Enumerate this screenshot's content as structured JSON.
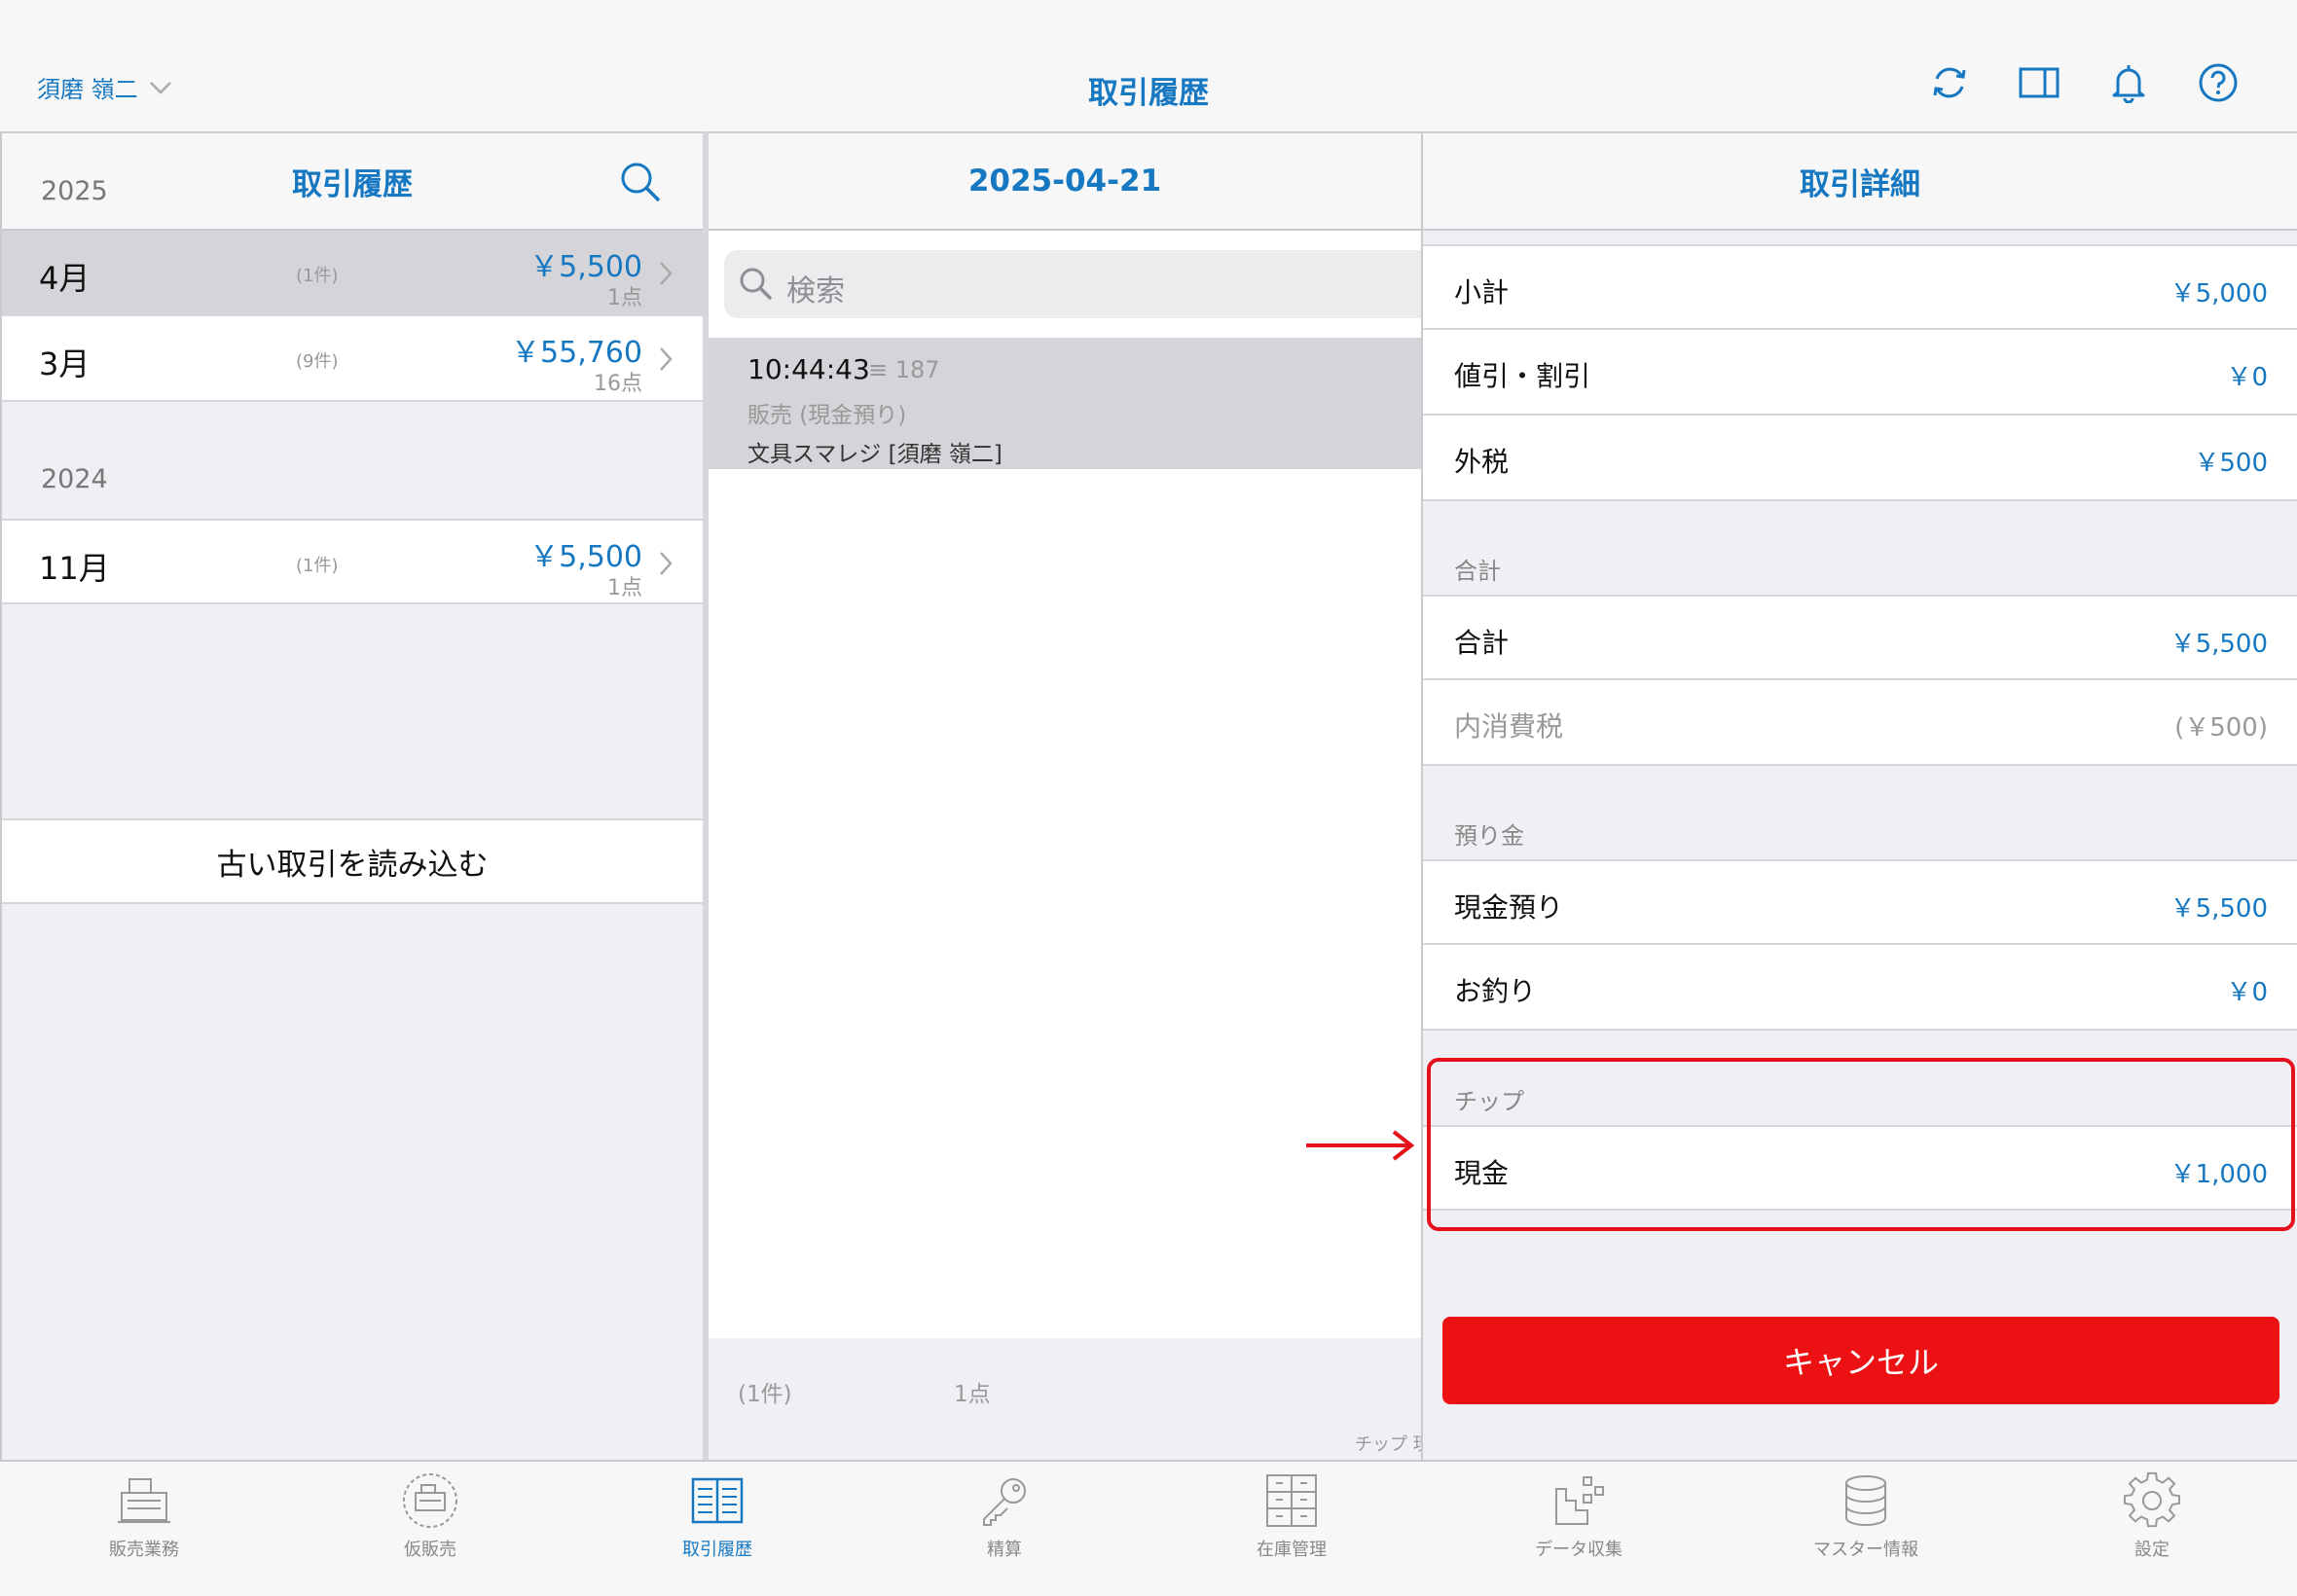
{
  "header": {
    "user": "須磨 嶺二",
    "title": "取引履歴",
    "icons": [
      "refresh-icon",
      "split-view-icon",
      "bell-icon",
      "help-icon"
    ]
  },
  "left": {
    "title": "取引履歴",
    "groups": [
      {
        "year": "2025",
        "months": [
          {
            "month": "4月",
            "count": "(1件)",
            "amount": "￥5,500",
            "points": "1点",
            "selected": true
          },
          {
            "month": "3月",
            "count": "(9件)",
            "amount": "￥55,760",
            "points": "16点",
            "selected": false
          }
        ]
      },
      {
        "year": "2024",
        "months": [
          {
            "month": "11月",
            "count": "(1件)",
            "amount": "￥5,500",
            "points": "1点",
            "selected": false
          }
        ]
      }
    ],
    "load_older": "古い取引を読み込む"
  },
  "middle": {
    "title": "2025-04-21",
    "search_placeholder": "検索",
    "transaction": {
      "time": "10:44:43",
      "seq": "187",
      "type": "販売 (現金預り)",
      "store": "文具スマレジ [須磨 嶺二]"
    },
    "footer": {
      "count": "(1件)",
      "points": "1点",
      "tip": "チップ 現"
    }
  },
  "right": {
    "title": "取引詳細",
    "rows1": [
      {
        "label": "小計",
        "value": "￥5,000"
      },
      {
        "label": "値引・割引",
        "value": "￥0"
      },
      {
        "label": "外税",
        "value": "￥500"
      }
    ],
    "section_total": "合計",
    "rows2": [
      {
        "label": "合計",
        "value": "￥5,500"
      },
      {
        "label": "内消費税",
        "value": "(￥500)"
      }
    ],
    "section_deposit": "預り金",
    "rows3": [
      {
        "label": "現金預り",
        "value": "￥5,500"
      },
      {
        "label": "お釣り",
        "value": "￥0"
      }
    ],
    "section_tip": "チップ",
    "tip_row": {
      "label": "現金",
      "value": "￥1,000"
    },
    "cancel": "キャンセル"
  },
  "tabs": [
    {
      "label": "販売業務",
      "icon": "register-icon",
      "active": false
    },
    {
      "label": "仮販売",
      "icon": "temp-register-icon",
      "active": false
    },
    {
      "label": "取引履歴",
      "icon": "history-book-icon",
      "active": true
    },
    {
      "label": "精算",
      "icon": "key-icon",
      "active": false
    },
    {
      "label": "在庫管理",
      "icon": "cabinet-icon",
      "active": false
    },
    {
      "label": "データ収集",
      "icon": "data-collect-icon",
      "active": false
    },
    {
      "label": "マスター情報",
      "icon": "database-icon",
      "active": false
    },
    {
      "label": "設定",
      "icon": "gear-icon",
      "active": false
    }
  ],
  "colors": {
    "accent": "#1778c2",
    "cancel": "#ec1213",
    "highlight": "#e6121a"
  }
}
